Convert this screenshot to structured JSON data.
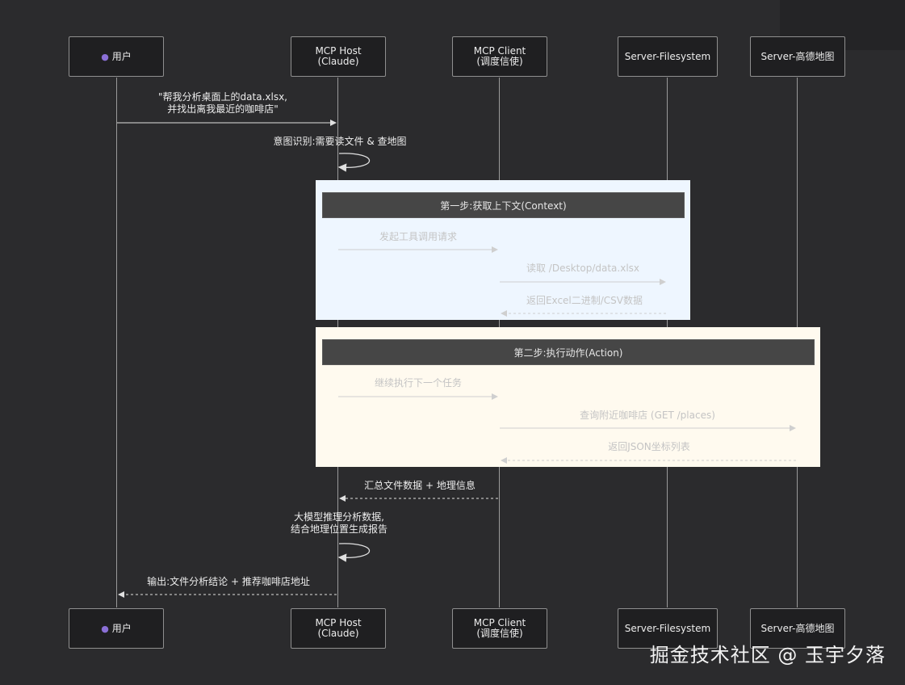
{
  "participants": {
    "user": {
      "line1": "用户",
      "icon": "user-icon"
    },
    "host": {
      "line1": "MCP Host",
      "line2": "(Claude)"
    },
    "client": {
      "line1": "MCP Client",
      "line2": "(调度信使)"
    },
    "filesystem": {
      "line1": "Server-Filesystem"
    },
    "amap": {
      "line1": "Server-高德地图"
    }
  },
  "messages": {
    "m1_line1": "\"帮我分析桌面上的data.xlsx,",
    "m1_line2": "并找出离我最近的咖啡店\"",
    "m2": "意图识别:需要读文件 & 查地图",
    "step1": "第一步:获取上下文(Context)",
    "m3": "发起工具调用请求",
    "m4": "读取 /Desktop/data.xlsx",
    "m5": "返回Excel二进制/CSV数据",
    "step2": "第二步:执行动作(Action)",
    "m6": "继续执行下一个任务",
    "m7": "查询附近咖啡店 (GET /places)",
    "m8": "返回JSON坐标列表",
    "m9": "汇总文件数据 + 地理信息",
    "m10_line1": "大模型推理分析数据,",
    "m10_line2": "结合地理位置生成报告",
    "m11": "输出:文件分析结论 + 推荐咖啡店地址"
  },
  "watermark": "掘金技术社区 @ 玉宇夕落",
  "colors": {
    "background": "#2b2b2d",
    "context_box": "#eef6ff",
    "action_box": "#fffaef",
    "user_icon": "#8a6fd6"
  }
}
